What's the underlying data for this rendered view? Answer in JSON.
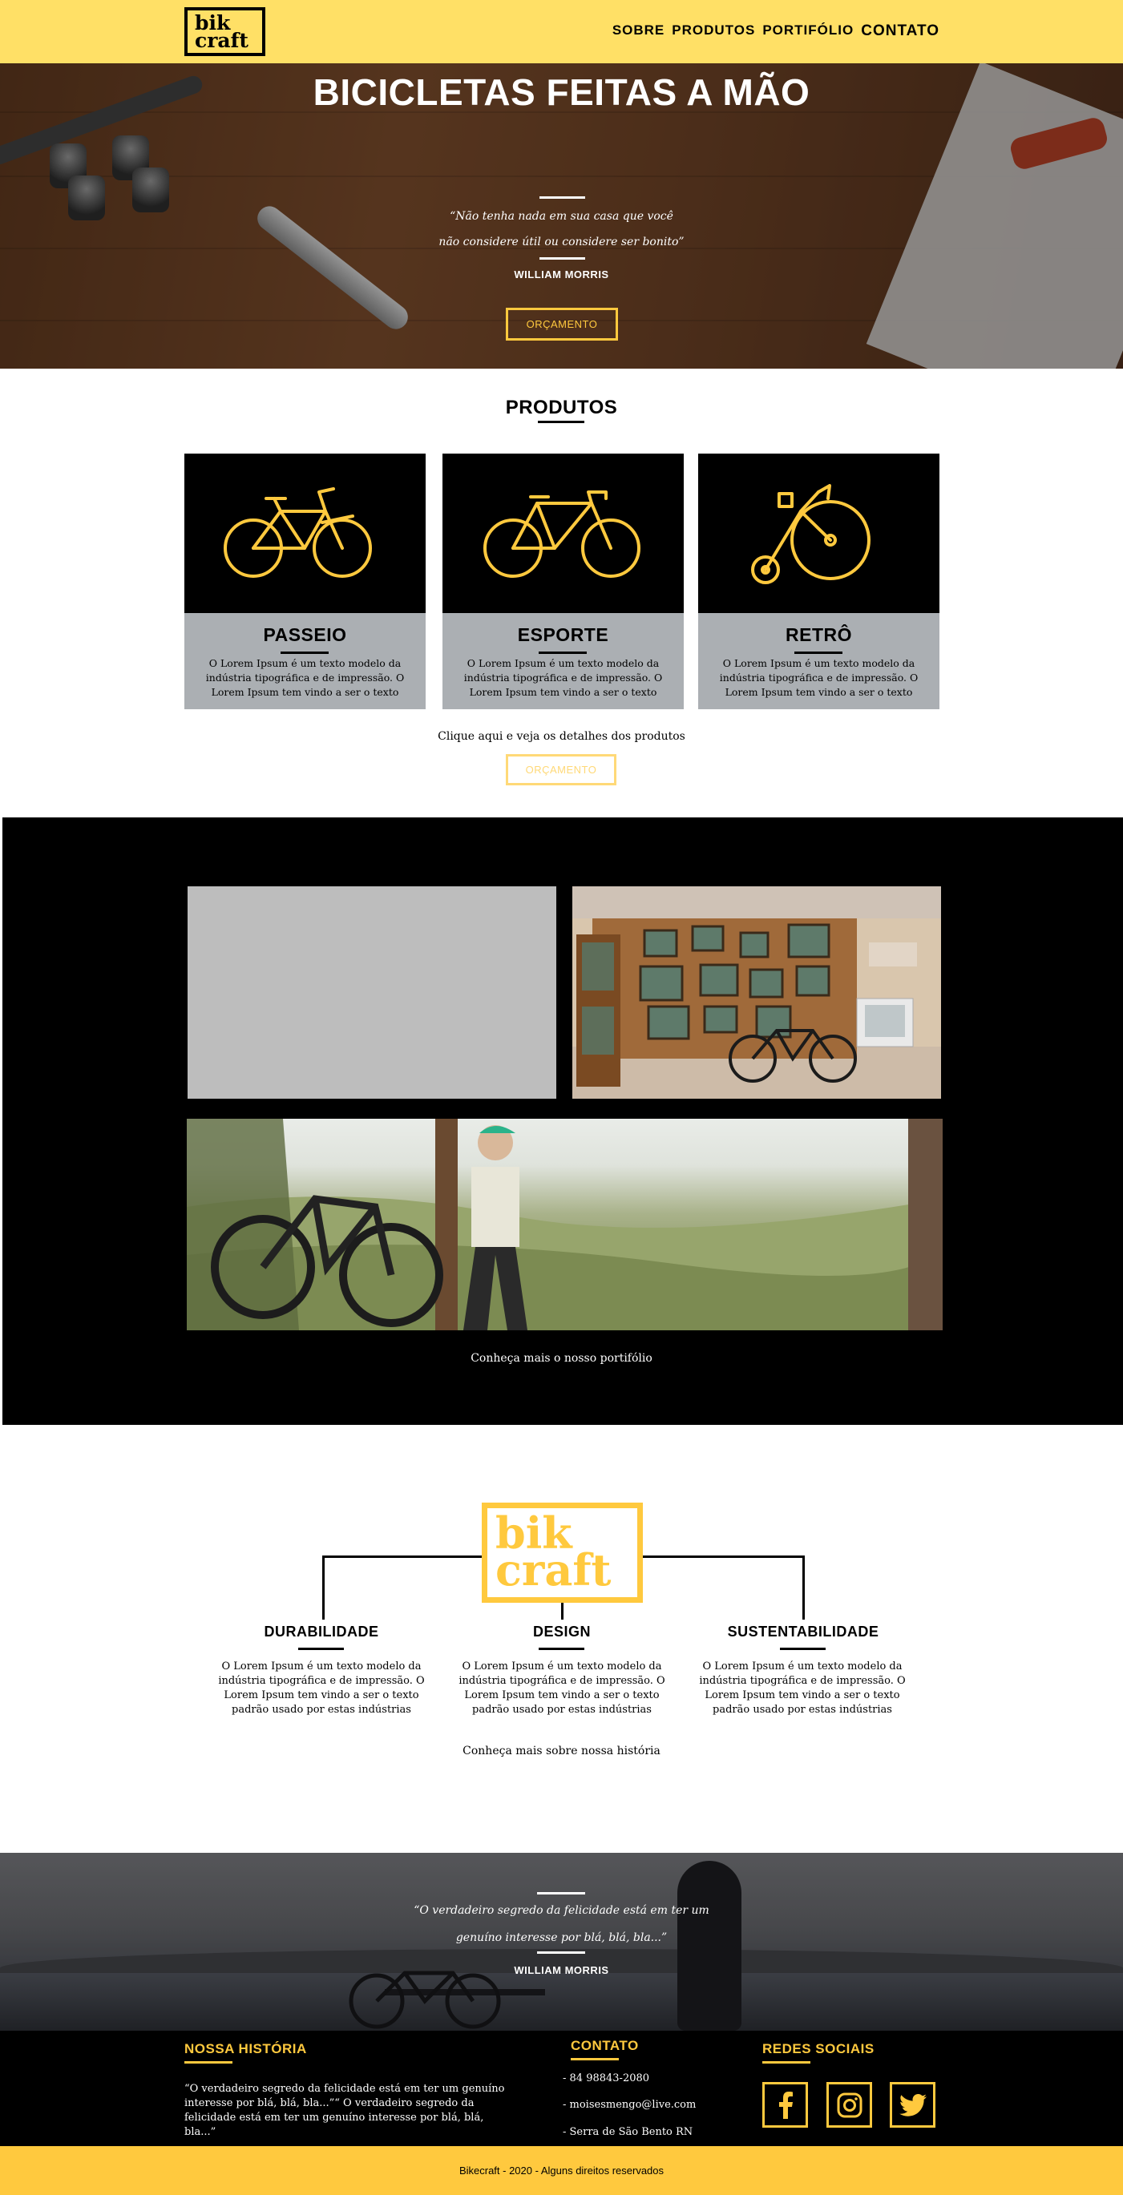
{
  "header": {
    "logo_line1": "bik",
    "logo_line2": "craft",
    "nav": [
      "SOBRE",
      "PRODUTOS",
      "PORTIFÓLIO",
      "CONTATO"
    ]
  },
  "hero": {
    "title": "BICICLETAS FEITAS A MÃO",
    "quote_line1": "“Não tenha nada em sua casa que você",
    "quote_line2": "não considere útil ou considere ser bonito”",
    "author": "WILLIAM MORRIS",
    "button": "ORÇAMENTO"
  },
  "produtos": {
    "title": "PRODUTOS",
    "cards": [
      {
        "name": "PASSEIO",
        "desc": "O Lorem Ipsum é um texto modelo da indústria tipográfica e de impressão. O Lorem Ipsum tem vindo a ser o texto",
        "icon": "city-bike-icon"
      },
      {
        "name": "ESPORTE",
        "desc": "O Lorem Ipsum é um texto modelo da indústria tipográfica e de impressão. O Lorem Ipsum tem vindo a ser o texto",
        "icon": "sport-bike-icon"
      },
      {
        "name": "RETRÔ",
        "desc": "O Lorem Ipsum é um texto modelo da indústria tipográfica e de impressão. O Lorem Ipsum tem vindo a ser o texto",
        "icon": "penny-farthing-icon"
      }
    ],
    "details_link": "Clique aqui e veja os detalhes dos produtos",
    "button": "ORÇAMENTO"
  },
  "portfolio": {
    "caption": "Conheça mais o nosso portifólio"
  },
  "sobre": {
    "logo_line1": "bik",
    "logo_line2": "craft",
    "features": [
      {
        "title": "DURABILIDADE",
        "desc": "O Lorem Ipsum é um texto modelo da indústria tipográfica e de impressão. O Lorem Ipsum tem vindo a ser o texto padrão usado por estas indústrias"
      },
      {
        "title": "DESIGN",
        "desc": "O Lorem Ipsum é um texto modelo da indústria tipográfica e de impressão. O Lorem Ipsum tem vindo a ser o texto padrão usado por estas indústrias"
      },
      {
        "title": "SUSTENTABILIDADE",
        "desc": "O Lorem Ipsum é um texto modelo da indústria tipográfica e de impressão. O Lorem Ipsum tem vindo a ser o texto padrão usado por estas indústrias"
      }
    ],
    "history_link": "Conheça mais sobre nossa história"
  },
  "quote": {
    "line1": "“O verdadeiro segredo da felicidade está em ter um",
    "line2": "genuíno interesse por blá, blá, bla...”",
    "author": "WILLIAM MORRIS"
  },
  "footer": {
    "history_title": "NOSSA HISTÓRIA",
    "history_text": "“O verdadeiro segredo da felicidade está em ter um genuíno interesse por blá, blá, bla...”“ O verdadeiro segredo da felicidade está em ter um genuíno interesse por blá, blá, bla...”",
    "contact_title": "CONTATO",
    "contact": [
      "- 84 98843-2080",
      "- moisesmengo@live.com",
      "- Serra de São Bento RN"
    ],
    "social_title": "REDES SOCIAIS",
    "social_icons": [
      "facebook-icon",
      "instagram-icon",
      "twitter-icon"
    ],
    "copyright": "Bikecraft - 2020 - Alguns direitos reservados"
  },
  "colors": {
    "header_bg": "#FFE066",
    "accent": "#FFC93E",
    "card_body": "#ABAFB3"
  }
}
